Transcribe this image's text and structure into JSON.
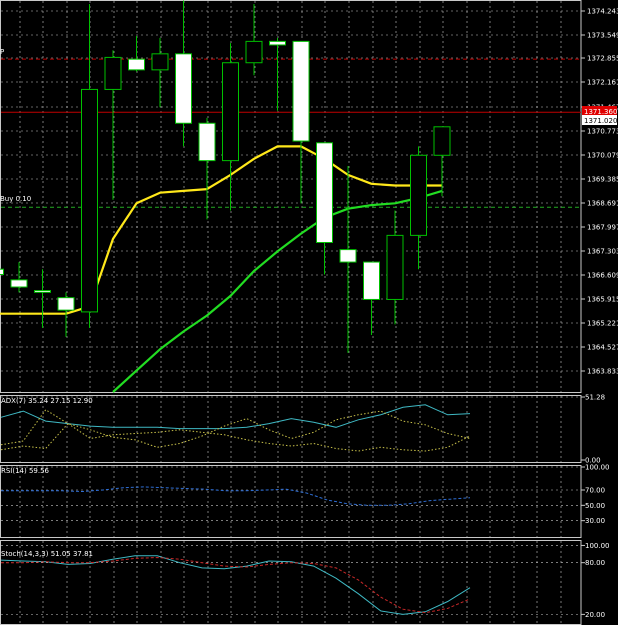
{
  "chart_data": [
    {
      "type": "candlestick",
      "panel": "price",
      "y_ticks": [
        "1374.243",
        "1373.549",
        "1372.855",
        "1372.161",
        "1371.467",
        "1370.773",
        "1370.079",
        "1369.385",
        "1368.691",
        "1367.997",
        "1367.303",
        "1366.609",
        "1365.915",
        "1365.221",
        "1364.527",
        "1363.833"
      ],
      "price_tags": [
        {
          "text": "1371.360",
          "color": "#e00000"
        },
        {
          "text": "1371.020",
          "color": "#ffffff"
        }
      ],
      "line_labels": [
        "P",
        "Buy 0.10"
      ],
      "level_lines": [
        {
          "value": 1372.85,
          "color": "#c00000",
          "style": "dashed"
        },
        {
          "value": 1371.36,
          "color": "#c00000",
          "style": "solid"
        },
        {
          "value": 1368.69,
          "color": "#22aa22",
          "style": "dashed"
        }
      ],
      "candles": [
        {
          "o": 1366.95,
          "h": 1367.5,
          "l": 1366.85,
          "c": 1366.8
        },
        {
          "o": 1366.65,
          "h": 1367.15,
          "l": 1366.3,
          "c": 1366.45
        },
        {
          "o": 1366.35,
          "h": 1366.95,
          "l": 1365.3,
          "c": 1366.3
        },
        {
          "o": 1366.15,
          "h": 1366.3,
          "l": 1365.05,
          "c": 1365.8
        },
        {
          "o": 1365.75,
          "h": 1374.4,
          "l": 1365.3,
          "c": 1372.0
        },
        {
          "o": 1372.0,
          "h": 1373.1,
          "l": 1368.9,
          "c": 1372.9
        },
        {
          "o": 1372.85,
          "h": 1373.5,
          "l": 1372.5,
          "c": 1372.55
        },
        {
          "o": 1372.55,
          "h": 1373.45,
          "l": 1371.5,
          "c": 1373.0
        },
        {
          "o": 1373.0,
          "h": 1374.5,
          "l": 1370.4,
          "c": 1371.05
        },
        {
          "o": 1371.05,
          "h": 1371.2,
          "l": 1368.35,
          "c": 1370.0
        },
        {
          "o": 1370.0,
          "h": 1373.3,
          "l": 1368.6,
          "c": 1372.75
        },
        {
          "o": 1372.75,
          "h": 1374.4,
          "l": 1372.4,
          "c": 1373.35
        },
        {
          "o": 1373.35,
          "h": 1373.45,
          "l": 1371.4,
          "c": 1373.25
        },
        {
          "o": 1373.35,
          "h": 1373.35,
          "l": 1368.8,
          "c": 1370.55
        },
        {
          "o": 1370.5,
          "h": 1370.5,
          "l": 1366.8,
          "c": 1367.7
        },
        {
          "o": 1367.5,
          "h": 1369.85,
          "l": 1364.6,
          "c": 1367.15
        },
        {
          "o": 1367.15,
          "h": 1367.15,
          "l": 1365.1,
          "c": 1366.1
        },
        {
          "o": 1366.1,
          "h": 1368.6,
          "l": 1365.4,
          "c": 1367.9
        },
        {
          "o": 1367.9,
          "h": 1370.4,
          "l": 1366.95,
          "c": 1370.15
        },
        {
          "o": 1370.15,
          "h": 1370.95,
          "l": 1369.0,
          "c": 1370.95
        }
      ],
      "ma_yellow": [
        1365.7,
        1365.7,
        1365.7,
        1365.7,
        1365.9,
        1367.8,
        1368.8,
        1369.1,
        1369.15,
        1369.2,
        1369.6,
        1370.05,
        1370.4,
        1370.4,
        1370.05,
        1369.6,
        1369.35,
        1369.3,
        1369.3,
        1369.3
      ],
      "ma_green": [
        null,
        null,
        null,
        null,
        null,
        1363.5,
        1364.1,
        1364.7,
        1365.2,
        1365.65,
        1366.2,
        1366.9,
        1367.45,
        1367.95,
        1368.4,
        1368.65,
        1368.75,
        1368.8,
        1368.95,
        1369.15
      ]
    },
    {
      "type": "line",
      "panel": "adx",
      "label": "ADX(7) 35.24 27.15 12.90",
      "y_ticks": [
        "51.28",
        "0.00"
      ],
      "series": [
        {
          "color": "#3fb9c4",
          "style": "solid",
          "values": [
            35,
            40,
            32,
            30,
            28,
            27,
            27,
            27,
            26,
            26,
            26,
            27,
            30,
            34,
            31,
            27,
            33,
            37,
            43,
            45,
            37,
            38
          ]
        },
        {
          "color": "#c9c24a",
          "style": "dotted",
          "values": [
            9,
            12,
            10,
            30,
            25,
            19,
            17,
            11,
            14,
            20,
            28,
            34,
            25,
            18,
            23,
            33,
            37,
            40,
            32,
            29,
            22,
            18
          ]
        },
        {
          "color": "#c9c24a",
          "style": "dotted",
          "values": [
            13,
            16,
            41,
            30,
            18,
            21,
            22,
            23,
            25,
            23,
            21,
            17,
            14,
            12,
            14,
            10,
            8,
            11,
            9,
            8,
            11,
            20
          ]
        }
      ]
    },
    {
      "type": "line",
      "panel": "rsi",
      "label": "RSI(14) 59.56",
      "y_ticks": [
        "100.00",
        "70.00",
        "50.00",
        "30.00"
      ],
      "series": [
        {
          "color": "#2f6fd6",
          "style": "dashed",
          "values": [
            69,
            69,
            69,
            69,
            68,
            70,
            73,
            74,
            73,
            72,
            71,
            69,
            69,
            70,
            71,
            66,
            57,
            52,
            50,
            50,
            52,
            56,
            58,
            60
          ]
        }
      ]
    },
    {
      "type": "line",
      "panel": "stochastic",
      "label": "Stoch(14,3,3) 51.05 37.81",
      "y_ticks": [
        "100.00",
        "80.00",
        "20.00"
      ],
      "series": [
        {
          "color": "#3fb9c4",
          "style": "solid",
          "values": [
            83,
            82,
            81,
            78,
            79,
            84,
            88,
            88,
            80,
            74,
            73,
            76,
            82,
            81,
            76,
            62,
            44,
            24,
            20,
            23,
            35,
            51
          ]
        },
        {
          "color": "#c62828",
          "style": "dashed",
          "values": [
            80,
            80,
            81,
            80,
            80,
            82,
            85,
            86,
            84,
            80,
            76,
            75,
            78,
            80,
            79,
            74,
            60,
            40,
            26,
            22,
            27,
            38
          ]
        }
      ]
    }
  ]
}
